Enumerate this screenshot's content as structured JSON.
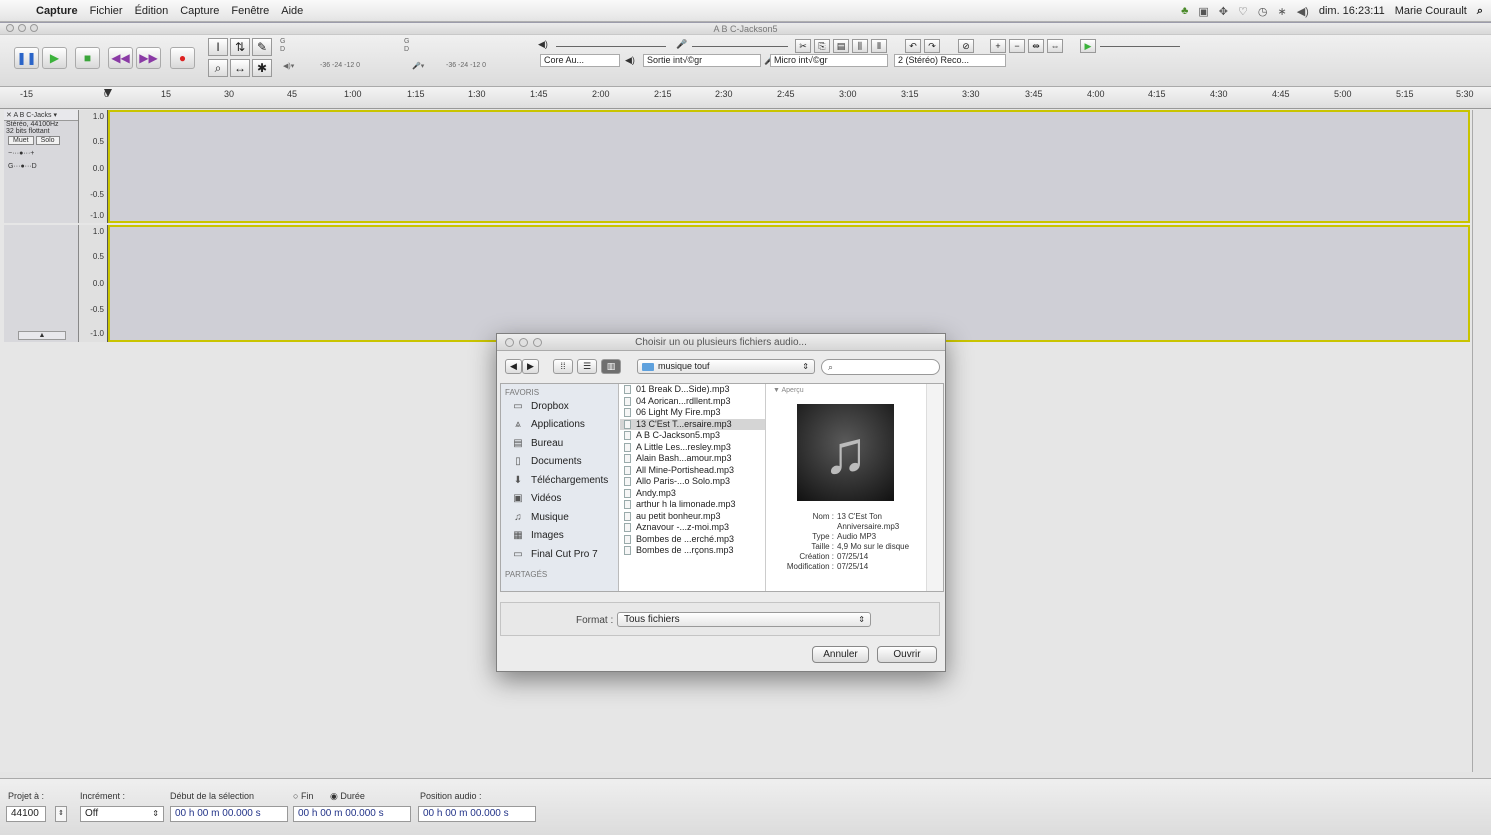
{
  "menubar": {
    "app": "Capture",
    "items": [
      "Fichier",
      "Édition",
      "Capture",
      "Fenêtre",
      "Aide"
    ],
    "clock": "dim. 16:23:11",
    "user": "Marie Courault"
  },
  "window": {
    "title": "A B C-Jackson5"
  },
  "toolbar": {
    "meter_left_top": "G",
    "meter_left_bottom": "D",
    "meter_right_top": "G",
    "meter_right_bottom": "D",
    "meter_scale": "-36  -24  -12  0",
    "host_device": "Core Au...",
    "output_device": "Sortie int√©gr",
    "input_device": "Micro int√©gr",
    "channels": "2 (Stéréo) Reco..."
  },
  "ruler": {
    "ticks": [
      "-15",
      "0",
      "15",
      "30",
      "45",
      "1:00",
      "1:15",
      "1:30",
      "1:45",
      "2:00",
      "2:15",
      "2:30",
      "2:45",
      "3:00",
      "3:15",
      "3:30",
      "3:45",
      "4:00",
      "4:15",
      "4:30",
      "4:45",
      "5:00",
      "5:15",
      "5:30"
    ]
  },
  "track": {
    "name": "A B C-Jacks",
    "rate": "Stéréo, 44100Hz",
    "format": "32 bits flottant",
    "mute": "Muet",
    "solo": "Solo",
    "scale_top": [
      "1.0",
      "0.5",
      "0.0",
      "-0.5",
      "-1.0"
    ],
    "scale_bottom": [
      "1.0",
      "0.5",
      "0.0",
      "-0.5",
      "-1.0"
    ]
  },
  "dialog": {
    "title": "Choisir un ou plusieurs fichiers audio...",
    "folder": "musique touf",
    "favorites_header": "FAVORIS",
    "shared_header": "PARTAGÉS",
    "sidebar": [
      {
        "label": "Dropbox",
        "icon": "folder-icon"
      },
      {
        "label": "Applications",
        "icon": "applications-icon"
      },
      {
        "label": "Bureau",
        "icon": "desktop-icon"
      },
      {
        "label": "Documents",
        "icon": "documents-icon"
      },
      {
        "label": "Téléchargements",
        "icon": "downloads-icon"
      },
      {
        "label": "Vidéos",
        "icon": "videos-icon"
      },
      {
        "label": "Musique",
        "icon": "music-icon"
      },
      {
        "label": "Images",
        "icon": "images-icon"
      },
      {
        "label": "Final Cut Pro 7",
        "icon": "folder-icon"
      }
    ],
    "files": [
      "01 Break D...Side).mp3",
      "04 Aorican...rdllent.mp3",
      "06 Light My Fire.mp3",
      "13 C'Est T...ersaire.mp3",
      "A B C-Jackson5.mp3",
      "A Little Les...resley.mp3",
      "Alain Bash...amour.mp3",
      "All Mine-Portishead.mp3",
      "Allo Paris-...o Solo.mp3",
      "Andy.mp3",
      "arthur h la limonade.mp3",
      "au petit bonheur.mp3",
      "Aznavour -...z-moi.mp3",
      "Bombes de ...erché.mp3",
      "Bombes de ...rçons.mp3"
    ],
    "selected_index": 3,
    "preview_header": "▼ Aperçu",
    "meta": [
      {
        "k": "Nom :",
        "v": "13 C'Est Ton Anniversaire.mp3"
      },
      {
        "k": "Type :",
        "v": "Audio MP3"
      },
      {
        "k": "Taille :",
        "v": "4,9 Mo sur le disque"
      },
      {
        "k": "Création :",
        "v": "07/25/14"
      },
      {
        "k": "Modification :",
        "v": "07/25/14"
      }
    ],
    "format_label": "Format :",
    "format_value": "Tous fichiers",
    "cancel": "Annuler",
    "open": "Ouvrir"
  },
  "bottom": {
    "project_rate_label": "Projet à :",
    "project_rate": "44100",
    "snap_label": "Incrément :",
    "snap_value": "Off",
    "sel_start_label": "Début de la sélection",
    "end_label": "Fin",
    "length_label": "Durée",
    "audio_pos_label": "Position audio :",
    "sel_start": "00 h 00 m 00.000 s",
    "sel_length": "00 h 00 m 00.000 s",
    "audio_pos": "00 h 00 m 00.000 s"
  }
}
